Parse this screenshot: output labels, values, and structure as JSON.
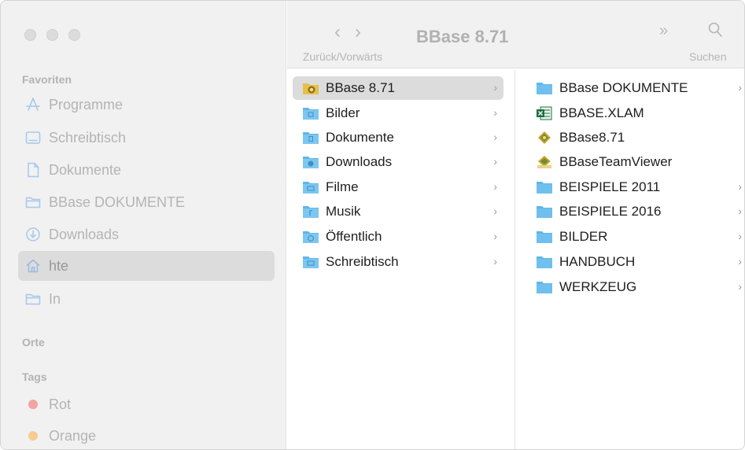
{
  "window": {
    "title": "BBase 8.71",
    "nav_caption": "Zurück/Vorwärts",
    "search_caption": "Suchen",
    "more_glyph": "»",
    "back_glyph": "‹",
    "forward_glyph": "›"
  },
  "sidebar": {
    "favorites_header": "Favoriten",
    "favorites": [
      {
        "label": "Programme",
        "icon": "apps-icon"
      },
      {
        "label": "Schreibtisch",
        "icon": "desktop-icon"
      },
      {
        "label": "Dokumente",
        "icon": "document-icon"
      },
      {
        "label": "BBase DOKUMENTE",
        "icon": "folder-icon"
      },
      {
        "label": "Downloads",
        "icon": "download-icon"
      },
      {
        "label": "hte",
        "icon": "home-icon",
        "selected": true
      },
      {
        "label": "In",
        "icon": "folder-icon"
      }
    ],
    "locations_header": "Orte",
    "tags_header": "Tags",
    "tags": [
      {
        "label": "Rot",
        "color": "#f2a3a3"
      },
      {
        "label": "Orange",
        "color": "#f5cc8f"
      }
    ]
  },
  "column1": {
    "items": [
      {
        "label": "BBase 8.71",
        "selected": true,
        "chevron": "›"
      },
      {
        "label": "Bilder",
        "chevron": "›"
      },
      {
        "label": "Dokumente",
        "chevron": "›"
      },
      {
        "label": "Downloads",
        "chevron": "›"
      },
      {
        "label": "Filme",
        "chevron": "›"
      },
      {
        "label": "Musik",
        "chevron": "›"
      },
      {
        "label": "Öffentlich",
        "chevron": "›"
      },
      {
        "label": "Schreibtisch",
        "chevron": "›"
      }
    ]
  },
  "column2": {
    "items": [
      {
        "label": "BBase DOKUMENTE",
        "chevron": "›"
      },
      {
        "label": "BBASE.XLAM"
      },
      {
        "label": "BBase8.71"
      },
      {
        "label": "BBaseTeamViewer"
      },
      {
        "label": "BEISPIELE 2011",
        "chevron": "›"
      },
      {
        "label": "BEISPIELE 2016",
        "chevron": "›"
      },
      {
        "label": "BILDER",
        "chevron": "›"
      },
      {
        "label": "HANDBUCH",
        "chevron": "›"
      },
      {
        "label": "WERKZEUG",
        "chevron": "›"
      }
    ]
  },
  "colors": {
    "folder_blue": "#5fb6ea",
    "excel_green": "#1d7044",
    "app_gold": "#c9a227",
    "selection": "#dcdcdc"
  }
}
